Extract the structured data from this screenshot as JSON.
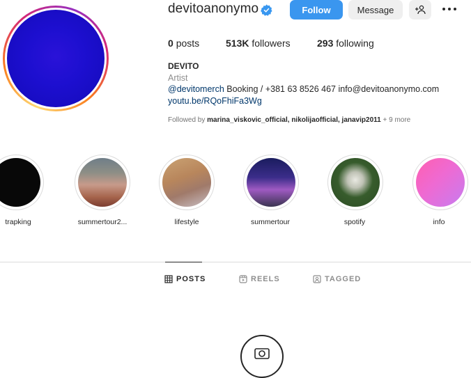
{
  "profile": {
    "username": "devitoanonymo",
    "verified": true,
    "avatar_color": "#1d0fd0"
  },
  "actions": {
    "follow": "Follow",
    "message": "Message",
    "add_user_icon": "person-plus-icon",
    "more_icon": "ellipsis-icon"
  },
  "stats": [
    {
      "value": "0",
      "label": "posts"
    },
    {
      "value": "513K",
      "label": "followers"
    },
    {
      "value": "293",
      "label": "following"
    }
  ],
  "bio": {
    "name": "DEVITO",
    "category": "Artist",
    "mention": "@devitomerch",
    "text_after_mention": " Booking / +381 63 8526 467 info@devitoanonymo.com",
    "link": "youtu.be/RQoFhiFa3Wg",
    "followed_by_prefix": "Followed by ",
    "followed_by_names": "marina_viskovic_official, nikolijaofficial, janavip2011",
    "followed_by_suffix": " + 9 more"
  },
  "highlights": [
    {
      "label": "trapking"
    },
    {
      "label": "summertour2..."
    },
    {
      "label": "lifestyle"
    },
    {
      "label": "summertour"
    },
    {
      "label": "spotify"
    },
    {
      "label": "info"
    }
  ],
  "tabs": [
    {
      "label": "POSTS",
      "icon": "grid-icon",
      "active": true
    },
    {
      "label": "REELS",
      "icon": "reels-icon",
      "active": false
    },
    {
      "label": "TAGGED",
      "icon": "tagged-icon",
      "active": false
    }
  ],
  "empty_state_icon": "camera-icon",
  "colors": {
    "primary_button": "#3a96ef",
    "link": "#00376b",
    "muted": "#8e8e8e"
  }
}
